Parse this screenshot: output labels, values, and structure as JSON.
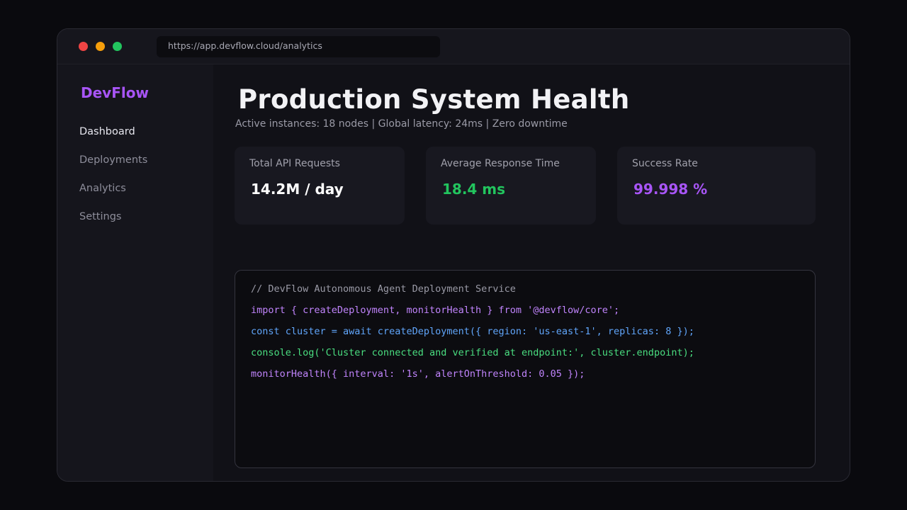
{
  "browser": {
    "url": "https://app.devflow.cloud/analytics"
  },
  "sidebar": {
    "brand": "DevFlow",
    "items": [
      {
        "label": "Dashboard",
        "active": true
      },
      {
        "label": "Deployments",
        "active": false
      },
      {
        "label": "Analytics",
        "active": false
      },
      {
        "label": "Settings",
        "active": false
      }
    ]
  },
  "main": {
    "title": "Production System Health",
    "subtitle": "Active instances: 18 nodes | Global latency: 24ms | Zero downtime",
    "cards": [
      {
        "label": "Total API Requests",
        "value": "14.2M / day",
        "color": "#ffffff"
      },
      {
        "label": "Average Response Time",
        "value": "18.4 ms",
        "color": "#22c55e"
      },
      {
        "label": "Success Rate",
        "value": "99.998 %",
        "color": "#a855f7"
      }
    ],
    "code_lines": [
      {
        "text": "// DevFlow Autonomous Agent Deployment Service",
        "color": "#9a9aa6"
      },
      {
        "text": "import { createDeployment, monitorHealth } from '@devflow/core';",
        "color": "#c084fc"
      },
      {
        "text": "const cluster = await createDeployment({ region: 'us-east-1', replicas: 8 });",
        "color": "#60a5fa"
      },
      {
        "text": "console.log('Cluster connected and verified at endpoint:', cluster.endpoint);",
        "color": "#4ade80"
      },
      {
        "text": "monitorHealth({ interval: '1s', alertOnThreshold: 0.05 });",
        "color": "#c084fc"
      }
    ]
  }
}
